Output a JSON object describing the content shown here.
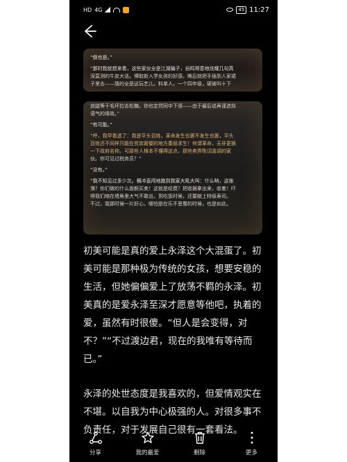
{
  "status": {
    "carrier": "HD",
    "network": "4G",
    "battery": "45",
    "time": "11:27"
  },
  "nav": {
    "back_icon": "back-arrow-icon"
  },
  "screenshot1": {
    "lines": [
      "“倒也是。”",
      "“那时我就想来看，这些家伙全是江湖骗子，自鸣得意地炫耀几句高",
      "深莫测的牛皮大话，博取新入学女孩的好感。瞧后就把手插到人家裙",
      "子里去——猜的全是这玩艺儿，料单人，一个四年级，硬被叫十下"
    ]
  },
  "screenshot2": {
    "lines": [
      "放腿等干毛坏拉去松糖。你也定然同中下语——由于最后说再谨选拟",
      "语气的缘故。”",
      "“有可能。”",
      "“呼，我早看透了：我是平头百姓，革命发生也罢不发生也罢，平头",
      "百姓还不同样只能在贫宾窘蹙的地方委屈求生！何谓革命，无非更换",
      "一下政府名称。可那些人根本不懂得这点，那些卖弄陈词滥调的家",
      "伙。你可见过税务员？”",
      "“没有。”",
      "“我不知见过多少次。横冲直闯地跑到我家大吼大叫：什么呐，这账",
      "簿？你们做的什么面额买卖！这就是经费？把收据拿出来，收着！吓",
      "得我们缩在墙角里大气不敢出，到吃饭时候，还要献上特级寿司。",
      "不过，我那时候一片好心，哪怕是在乐不思蜀的时候，也是如此。"
    ]
  },
  "article": {
    "p1": "初美可能是真的爱上永泽这个大混蛋了。初美可能是那种极为传统的女孩，想要安稳的生活，但她偏偏爱上了放荡不羁的永泽。初美真的是爱永泽至深才愿意等他吧，执着的爱，虽然有时很傻。“但人是会变得，对不？”“不过渡边君，现在的我唯有等待而已。”",
    "p2": "永泽的处世态度是我喜欢的，但爱情观实在不堪。以自我为中心极强的人。对很多事不负责任，对于发展自己很有一套看法。"
  },
  "toolbar": {
    "share_label": "分享",
    "favorite_label": "我的最爱",
    "delete_label": "删除",
    "more_label": "更多"
  }
}
